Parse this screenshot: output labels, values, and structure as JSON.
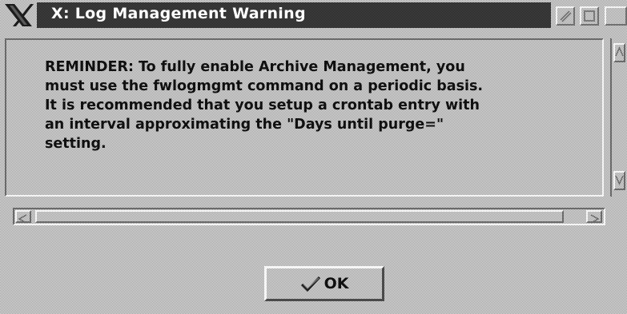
{
  "window": {
    "title": "X: Log Management Warning",
    "icons": [
      "x-logo-icon",
      "minimize-icon",
      "maximize-icon"
    ]
  },
  "message": {
    "text": "REMINDER: To fully enable Archive Management, you\nmust use the fwlogmgmt command on a periodic basis.\nIt is recommended that you setup a crontab entry with\nan interval approximating the \"Days until purge=\"\nsetting."
  },
  "buttons": {
    "ok_label": "OK",
    "ok_icon": "checkmark-icon"
  },
  "colors": {
    "title_bar": "#2e2e2e",
    "title_text": "#ffffff",
    "background": "#c6c6c6"
  }
}
